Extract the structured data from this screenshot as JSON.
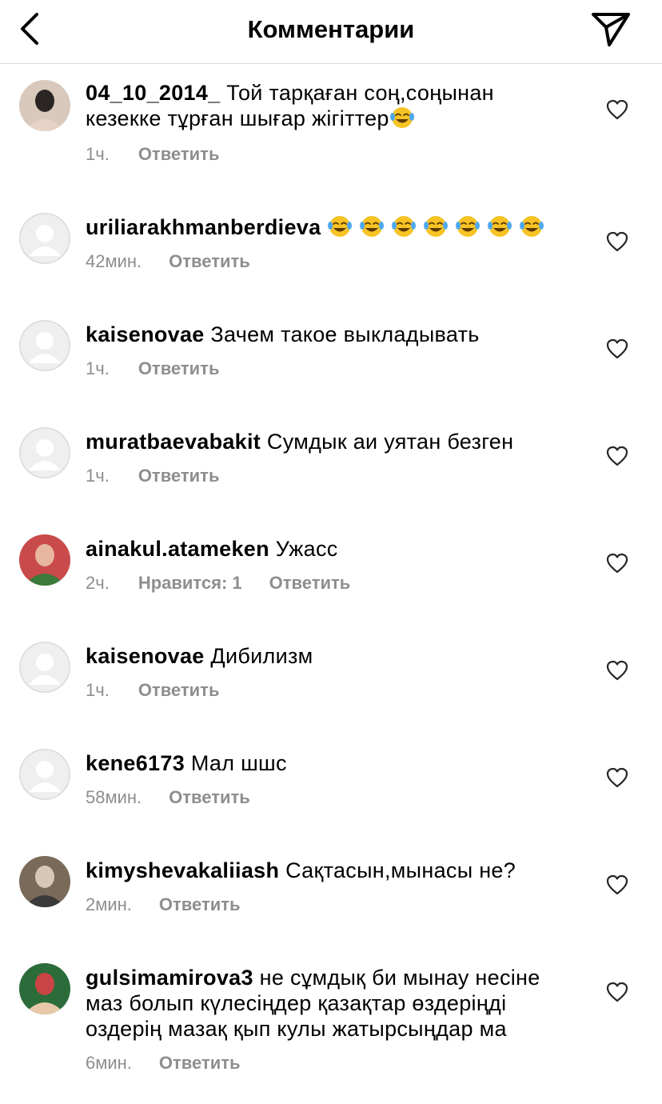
{
  "header": {
    "title": "Комментарии",
    "back_icon": "chevron-left-icon",
    "send_icon": "paper-plane-icon"
  },
  "emoji": {
    "name": "face-with-tears-of-joy",
    "face_color": "#f7c325",
    "tear_color": "#4fa8f0"
  },
  "comments": [
    {
      "username": "04_10_2014_",
      "text": "Той тарқаған соң,соңынан кезекке тұрған шығар жігіттер",
      "emoji_count": 1,
      "time": "1ч.",
      "likes": "",
      "reply": "Ответить",
      "avatar": "photo"
    },
    {
      "username": "uriliarakhmanberdieva",
      "text": "",
      "emoji_count": 7,
      "time": "42мин.",
      "likes": "",
      "reply": "Ответить",
      "avatar": "default"
    },
    {
      "username": "kaisenovae",
      "text": "Зачем такое выкладывать",
      "emoji_count": 0,
      "time": "1ч.",
      "likes": "",
      "reply": "Ответить",
      "avatar": "default"
    },
    {
      "username": "muratbaevabakit",
      "text": "Сумдык аи уятан безген",
      "emoji_count": 0,
      "time": "1ч.",
      "likes": "",
      "reply": "Ответить",
      "avatar": "default"
    },
    {
      "username": "ainakul.atameken",
      "text": "Ужасс",
      "emoji_count": 0,
      "time": "2ч.",
      "likes": "Нравится: 1",
      "reply": "Ответить",
      "avatar": "photo"
    },
    {
      "username": "kaisenovae",
      "text": "Дибилизм",
      "emoji_count": 0,
      "time": "1ч.",
      "likes": "",
      "reply": "Ответить",
      "avatar": "default"
    },
    {
      "username": "kene6173",
      "text": "Мал шшс",
      "emoji_count": 0,
      "time": "58мин.",
      "likes": "",
      "reply": "Ответить",
      "avatar": "default"
    },
    {
      "username": "kimyshevakaliiash",
      "text": "Сақтасын,мынасы не?",
      "emoji_count": 0,
      "time": "2мин.",
      "likes": "",
      "reply": "Ответить",
      "avatar": "photo"
    },
    {
      "username": "gulsimamirova3",
      "text": "не сұмдық би мынау несіне маз болып күлесіңдер қазақтар өздеріңді оздерің мазақ қып кулы жатырсыңдар ма",
      "emoji_count": 0,
      "time": "6мин.",
      "likes": "",
      "reply": "Ответить",
      "avatar": "photo"
    }
  ]
}
